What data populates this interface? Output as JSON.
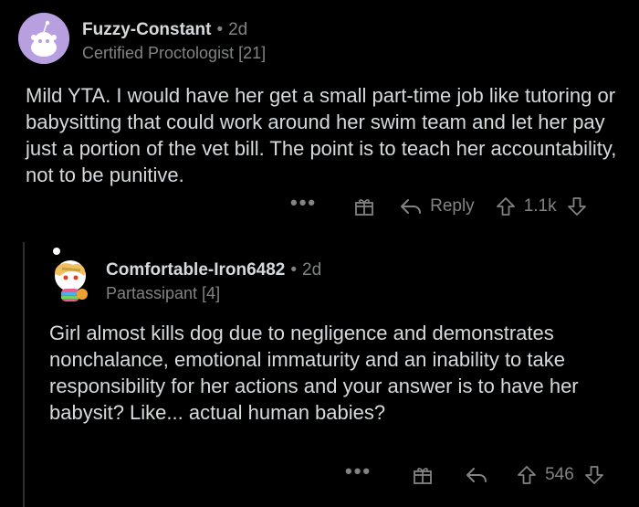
{
  "comment1": {
    "username": "Fuzzy-Constant",
    "separator": "•",
    "age": "2d",
    "flair": "Certified Proctologist [21]",
    "body": "Mild YTA.  I would have her get a small part-time job like tutoring or babysitting that could work around her swim team and let her pay just a portion of the vet bill.  The point is to teach her accountability, not to be punitive.",
    "more_label": "•••",
    "reply_label": "Reply",
    "score": "1.1k",
    "avatar_color": "#b79fe0"
  },
  "comment2": {
    "username": "Comfortable-Iron6482",
    "separator": "•",
    "age": "2d",
    "flair": "Partassipant [4]",
    "body": "Girl almost kills dog due to negligence and demonstrates nonchalance, emotional immaturity and an inability to take responsibility for her actions and your answer is to have her babysit? Like... actual human babies?",
    "more_label": "•••",
    "score": "546"
  },
  "icons": [
    "snoo-avatar-icon",
    "more-icon",
    "award-gift-icon",
    "reply-arrow-icon",
    "upvote-icon",
    "downvote-icon"
  ]
}
